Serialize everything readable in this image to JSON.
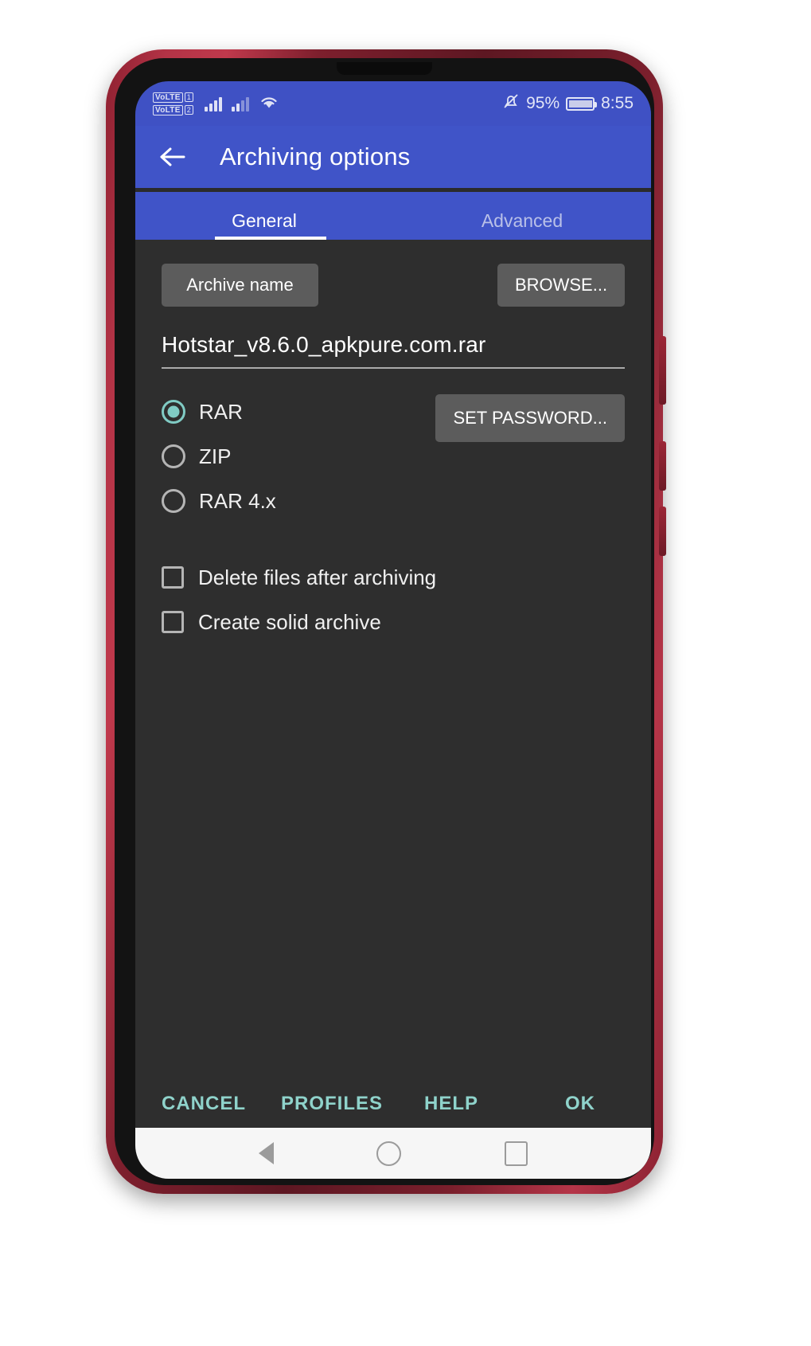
{
  "status_bar": {
    "volte_1_label": "VoLTE",
    "volte_1_sim": "1",
    "volte_2_label": "VoLTE",
    "volte_2_sim": "2",
    "signal_1_icon": "signal-bars-icon",
    "signal_2_icon": "signal-bars-icon",
    "wifi_icon": "wifi-icon",
    "mute_icon": "bell-muted-icon",
    "battery_percent": "95%",
    "battery_icon": "battery-icon",
    "time": "8:55"
  },
  "app_bar": {
    "back_icon": "arrow-left-icon",
    "title": "Archiving options"
  },
  "tabs": [
    {
      "label": "General",
      "active": true
    },
    {
      "label": "Advanced",
      "active": false
    }
  ],
  "main": {
    "archive_name_button": "Archive name",
    "browse_button": "BROWSE...",
    "archive_name_value": "Hotstar_v8.6.0_apkpure.com.rar",
    "archive_name_placeholder": "Archive name",
    "set_password_button": "SET PASSWORD...",
    "format_options": [
      {
        "label": "RAR",
        "selected": true
      },
      {
        "label": "ZIP",
        "selected": false
      },
      {
        "label": "RAR 4.x",
        "selected": false
      }
    ],
    "checkboxes": [
      {
        "label": "Delete files after archiving",
        "checked": false
      },
      {
        "label": "Create solid archive",
        "checked": false
      }
    ]
  },
  "actions": [
    {
      "label": "CANCEL"
    },
    {
      "label": "PROFILES"
    },
    {
      "label": "HELP"
    },
    {
      "label": "OK"
    }
  ],
  "nav_bar": {
    "back_icon": "triangle-back-icon",
    "home_icon": "circle-home-icon",
    "recents_icon": "square-recents-icon"
  },
  "colors": {
    "accent_blue": "#4054c8",
    "status_blue": "#3f51c4",
    "teal_accent": "#80cbc4",
    "surface_dark": "#2e2e2e",
    "button_grey": "#5c5c5c"
  }
}
